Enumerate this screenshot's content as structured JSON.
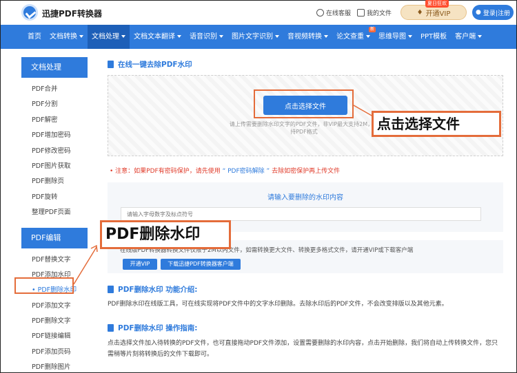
{
  "header": {
    "brand": "迅捷PDF转换器",
    "service": "在线客服",
    "my_files": "我的文件",
    "vip_badge": "夏日狂欢",
    "vip_label": "开通VIP",
    "login_label": "登录|注册"
  },
  "nav": {
    "items": [
      {
        "label": "首页",
        "caret": false
      },
      {
        "label": "文档转换",
        "caret": true
      },
      {
        "label": "文档处理",
        "caret": true,
        "active": true
      },
      {
        "label": "文档文本翻译",
        "caret": true
      },
      {
        "label": "语音识别",
        "caret": true
      },
      {
        "label": "图片文字识别",
        "caret": true
      },
      {
        "label": "音视频转换",
        "caret": true
      },
      {
        "label": "论文查重",
        "caret": true,
        "badge": "新"
      },
      {
        "label": "思维导图",
        "caret": true
      },
      {
        "label": "PPT模板",
        "caret": false
      },
      {
        "label": "客户端",
        "caret": true
      }
    ]
  },
  "sidebar": {
    "group1_title": "文档处理",
    "group1_items": [
      "PDF合并",
      "PDF分割",
      "PDF解密",
      "PDF增加密码",
      "PDF修改密码",
      "PDF图片获取",
      "PDF删除页",
      "PDF旋转",
      "整理PDF页面"
    ],
    "group2_title": "PDF编辑",
    "group2_items": [
      "PDF替换文字",
      "PDF添加水印",
      "PDF删除水印",
      "PDF添加文字",
      "PDF删除文字",
      "PDF链接编辑",
      "PDF添加页码",
      "PDF删除图片"
    ],
    "active_item": "PDF删除水印"
  },
  "main": {
    "title": "在线一键去除PDF水印",
    "choose_button": "点击选择文件",
    "upload_tip": "请上传需要删除水印文字的PDF文件，非VIP最大支持2M，支持PDF格式",
    "notice_prefix": "注意：如果PDF有密码保护，请先使用",
    "notice_link": "“ PDF密码解除 ”",
    "notice_suffix": "去除如密保护再上传文件",
    "watermark_title": "请输入要删除的水印内容",
    "watermark_placeholder": "请输入字母数字及标点符号",
    "limit_text": "在线版PDF转换器转换文件仅限于2M以内文件，如需转换更大文件、转换更多格式文件，请开通VIP或下载客户端",
    "open_vip": "开通VIP",
    "download_client": "下载迅捷PDF转换器客户端",
    "intro_title": "PDF删除水印 功能介绍:",
    "intro_text": "PDF删除水印在线版工具，可在线实现将PDF文件中的文字水印删除。去除水印后的PDF文件，不会改变排版以及其他元素。",
    "guide_title": "PDF删除水印 操作指南:",
    "guide_text": "点击选择文件加入待转换的PDF文件，也可直接拖动PDF文件添加，设置需要删除的水印内容，点击开始删除，我们将自动上传转换文件，您只需稍等片刻将转换后的文件下载即可。"
  },
  "annotations": {
    "callout_choose": "点击选择文件",
    "callout_remove": "PDF删除水印"
  },
  "colors": {
    "brand_blue": "#2f7bdc",
    "annotation_orange": "#e46c3a",
    "warning_red": "#e03b2a"
  }
}
